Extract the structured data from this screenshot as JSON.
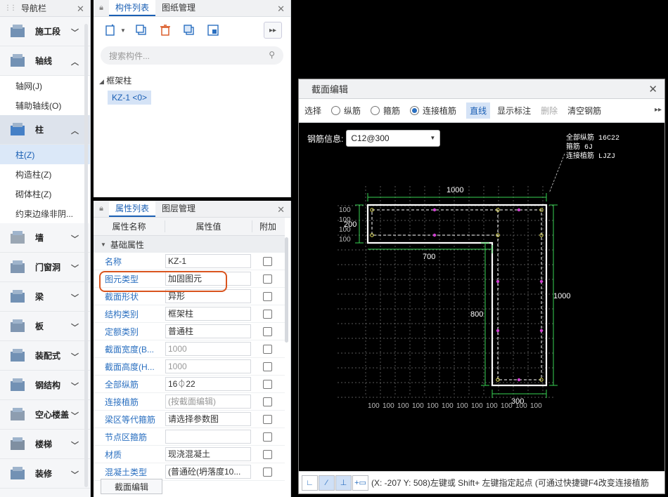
{
  "nav": {
    "title": "导航栏",
    "categories": [
      {
        "label": "施工段"
      },
      {
        "label": "轴线"
      },
      {
        "label": "柱"
      },
      {
        "label": "墙"
      },
      {
        "label": "门窗洞"
      },
      {
        "label": "梁"
      },
      {
        "label": "板"
      },
      {
        "label": "装配式"
      },
      {
        "label": "钢结构"
      },
      {
        "label": "空心楼盖"
      },
      {
        "label": "楼梯"
      },
      {
        "label": "装修"
      }
    ],
    "axis_items": [
      "轴网(J)",
      "辅助轴线(O)"
    ],
    "column_items": [
      "柱(Z)",
      "构造柱(Z)",
      "砌体柱(Z)",
      "约束边缘非阴..."
    ]
  },
  "component_panel": {
    "tabs": [
      "构件列表",
      "图纸管理"
    ],
    "search_placeholder": "搜索构件...",
    "tree_group": "框架柱",
    "tree_item": "KZ-1 <0>"
  },
  "properties_panel": {
    "tabs": [
      "属性列表",
      "图层管理"
    ],
    "headers": [
      "属性名称",
      "属性值",
      "附加"
    ],
    "group": "基础属性",
    "rows": [
      {
        "name": "名称",
        "value": "KZ-1"
      },
      {
        "name": "图元类型",
        "value": "加固图元"
      },
      {
        "name": "截面形状",
        "value": "异形"
      },
      {
        "name": "结构类别",
        "value": "框架柱"
      },
      {
        "name": "定额类别",
        "value": "普通柱"
      },
      {
        "name": "截面宽度(B...",
        "value": "1000"
      },
      {
        "name": "截面高度(H...",
        "value": "1000"
      },
      {
        "name": "全部纵筋",
        "value": "16⏀22"
      },
      {
        "name": "连接植筋",
        "value": "(按截面编辑)"
      },
      {
        "name": "梁区等代箍筋",
        "value": "请选择参数图"
      },
      {
        "name": "节点区箍筋",
        "value": ""
      },
      {
        "name": "材质",
        "value": "现浇混凝土"
      },
      {
        "name": "混凝土类型",
        "value": "(普通砼(坍落度10..."
      }
    ],
    "section_edit_button": "截面编辑"
  },
  "dialog": {
    "title": "截面编辑",
    "toolbar": {
      "select": "选择",
      "longitudinal": "纵筋",
      "stirrup": "箍筋",
      "connect_plant": "连接植筋",
      "straight": "直线",
      "show_marks": "显示标注",
      "delete": "删除",
      "clear": "清空钢筋"
    },
    "steel_info_label": "钢筋信息:",
    "steel_info_value": "C12@300",
    "legend": [
      "全部纵筋  16C22",
      "箍筋  6J",
      "连接植筋  LJZJ"
    ],
    "dims": {
      "top": "1000",
      "left": "200",
      "inner": "700",
      "right": "1000",
      "mid": "800",
      "bottom": "300",
      "grid": "100"
    },
    "status": "(X: -207 Y: 508)左键或 Shift+ 左键指定起点 (可通过快捷键F4改变连接植筋"
  }
}
